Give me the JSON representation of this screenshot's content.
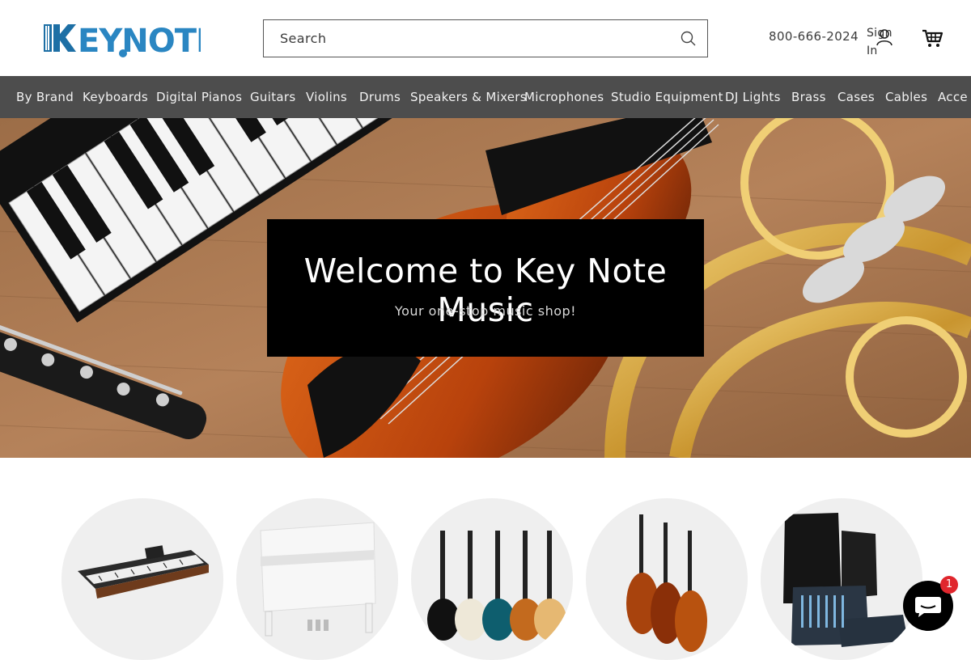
{
  "brand": {
    "logo_text": "KEYNOTE",
    "colors": {
      "logo_blue": "#1d6fa5",
      "logo_light": "#4fa6d8"
    }
  },
  "header": {
    "search": {
      "placeholder": "Search"
    },
    "phone": "800-666-2024",
    "signin_label": "Sign In",
    "icons": {
      "search": "search-icon",
      "user": "user-icon",
      "cart": "cart-icon"
    }
  },
  "nav": {
    "items": [
      {
        "label": "By Brand"
      },
      {
        "label": "Keyboards"
      },
      {
        "label": "Digital Pianos"
      },
      {
        "label": "Guitars"
      },
      {
        "label": "Violins"
      },
      {
        "label": "Drums"
      },
      {
        "label": "Speakers & Mixers"
      },
      {
        "label": "Microphones"
      },
      {
        "label": "Studio Equipment"
      },
      {
        "label": "DJ Lights"
      },
      {
        "label": "Brass"
      },
      {
        "label": "Cases"
      },
      {
        "label": "Cables"
      },
      {
        "label": "Acce"
      }
    ]
  },
  "hero": {
    "title": "Welcome to Key Note Music",
    "subtitle": "Your one-stop music shop!"
  },
  "categories": [
    {
      "image": "keyboard-image"
    },
    {
      "image": "digital-piano-image"
    },
    {
      "image": "guitars-image"
    },
    {
      "image": "violins-image"
    },
    {
      "image": "speakers-mixer-image"
    }
  ],
  "chat": {
    "badge_count": "1",
    "icon": "chat-icon"
  }
}
